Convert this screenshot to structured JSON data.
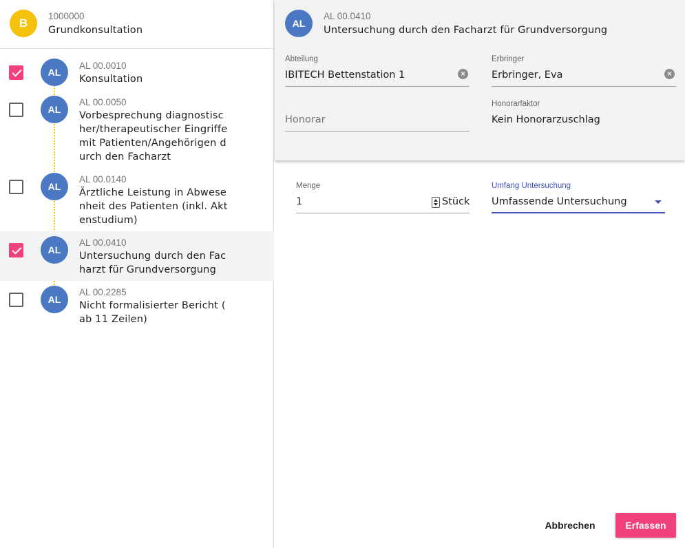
{
  "header": {
    "avatar": "B",
    "code": "1000000",
    "title": "Grundkonsultation"
  },
  "items": [
    {
      "checked": true,
      "avatar": "AL",
      "code": "AL 00.0010",
      "lines": [
        "Konsultation"
      ]
    },
    {
      "checked": false,
      "avatar": "AL",
      "code": "AL 00.0050",
      "lines": [
        "Vorbesprechung diagnostisc",
        "her/therapeutischer Eingriffe",
        "mit Patienten/Angehörigen d",
        "urch den Facharzt"
      ]
    },
    {
      "checked": false,
      "avatar": "AL",
      "code": "AL 00.0140",
      "lines": [
        "Ärztliche Leistung in Abwese",
        "nheit des Patienten (inkl. Akt",
        "enstudium)"
      ]
    },
    {
      "checked": true,
      "avatar": "AL",
      "code": "AL 00.0410",
      "lines": [
        "Untersuchung durch den Fac",
        "harzt für Grundversorgung"
      ],
      "selected": true
    },
    {
      "checked": false,
      "avatar": "AL",
      "code": "AL 00.2285",
      "lines": [
        "Nicht formalisierter Bericht (",
        "ab 11 Zeilen)"
      ]
    }
  ],
  "detail": {
    "avatar": "AL",
    "code": "AL 00.0410",
    "title": "Untersuchung durch den Facharzt für Grundversorgung",
    "abteilung_label": "Abteilung",
    "abteilung_value": "IBITECH Bettenstation 1",
    "erbringer_label": "Erbringer",
    "erbringer_value": "Erbringer, Eva",
    "honorar_placeholder": "Honorar",
    "honorarfaktor_label": "Honorarfaktor",
    "honorarfaktor_value": "Kein Honorarzuschlag",
    "clear_symbol": "×"
  },
  "form": {
    "menge_label": "Menge",
    "menge_value": "1",
    "menge_unit": "Stück",
    "umfang_label": "Umfang Untersuchung",
    "umfang_value": "Umfassende Untersuchung"
  },
  "actions": {
    "cancel_label": "Abbrechen",
    "submit_label": "Erfassen"
  },
  "colors": {
    "accent": "#f0417c",
    "avatar_blue": "#4a78c2",
    "avatar_yellow": "#f6c10a",
    "select_underline": "#3f51b5"
  }
}
